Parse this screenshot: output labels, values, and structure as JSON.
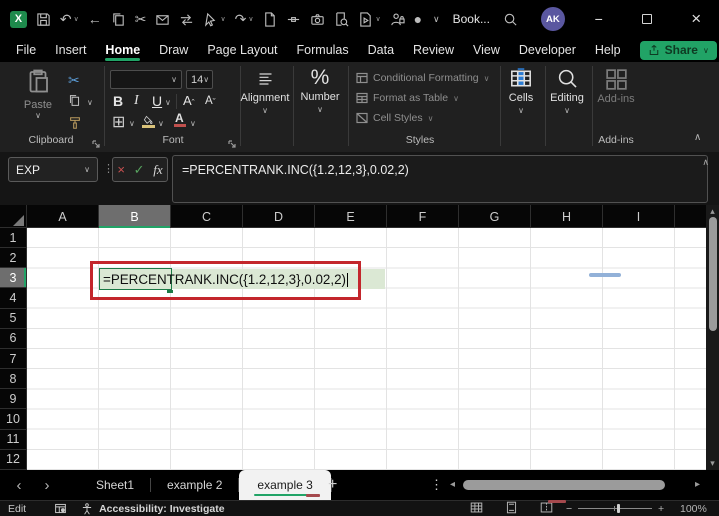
{
  "colors": {
    "accent_green": "#21a366",
    "titlebar_bg": "#000000",
    "ribbon_bg": "#202020",
    "cell_fill_green": "#dbe8d4",
    "annotation_red": "#c3262c",
    "avatar_purple": "#5a57a0",
    "scrollbar_thumb": "#9b9b9b",
    "blue_mark": "#92b1d8",
    "font_color_red": "#c0504d",
    "fill_color_yellow": "#d9c27a",
    "cut_blue": "#5b9bd5"
  },
  "titlebar": {
    "title": "Book...",
    "avatar": "AK"
  },
  "icons": {
    "excel_x": "X",
    "undo": "↶",
    "redo": "↷",
    "back": "←",
    "cut": "✂",
    "record": "●",
    "chevron": "∨",
    "chevron_up": "∧",
    "caret_up": "ˆ",
    "caret_down": "ˇ",
    "minimize": "−",
    "close": "×",
    "nav_left": "‹",
    "nav_right": "›",
    "plus": "+",
    "dots": "⋮",
    "scroll_left": "◂",
    "scroll_right": "▸",
    "scroll_up": "▴",
    "scroll_down": "▾",
    "borders": "⊞",
    "percent": "%",
    "bold": "B",
    "italic": "I",
    "underline": "U",
    "letter_a": "A",
    "cancel": "×",
    "enter": "✓",
    "fx": "fx"
  },
  "menu": {
    "tabs": [
      "File",
      "Insert",
      "Home",
      "Draw",
      "Page Layout",
      "Formulas",
      "Data",
      "Review",
      "View",
      "Developer",
      "Help"
    ],
    "active_tab": "Home",
    "share": "Share"
  },
  "ribbon": {
    "paste": "Paste",
    "clipboard_label": "Clipboard",
    "font_label": "Font",
    "font_size": "14",
    "alignment": "Alignment",
    "number": "Number",
    "styles": {
      "label": "Styles",
      "conditional": "Conditional Formatting",
      "format_table": "Format as Table",
      "cell_styles": "Cell Styles"
    },
    "cells": "Cells",
    "editing": "Editing",
    "addins": "Add-ins",
    "addins_group": "Add-ins"
  },
  "formula_bar": {
    "name_box": "EXP",
    "formula": "=PERCENTRANK.INC({1.2,12,3},0.02,2)"
  },
  "grid": {
    "columns": [
      "A",
      "B",
      "C",
      "D",
      "E",
      "F",
      "G",
      "H",
      "I"
    ],
    "rows": [
      "1",
      "2",
      "3",
      "4",
      "5",
      "6",
      "7",
      "8",
      "9",
      "10",
      "11",
      "12"
    ],
    "selected_column": "B",
    "selected_row": "3"
  },
  "sheet_tabs": {
    "tabs": [
      "Sheet1",
      "example 2",
      "example 3"
    ],
    "active": "example 3"
  },
  "status": {
    "mode": "Edit",
    "accessibility": "Accessibility: Investigate",
    "zoom": "100%"
  }
}
